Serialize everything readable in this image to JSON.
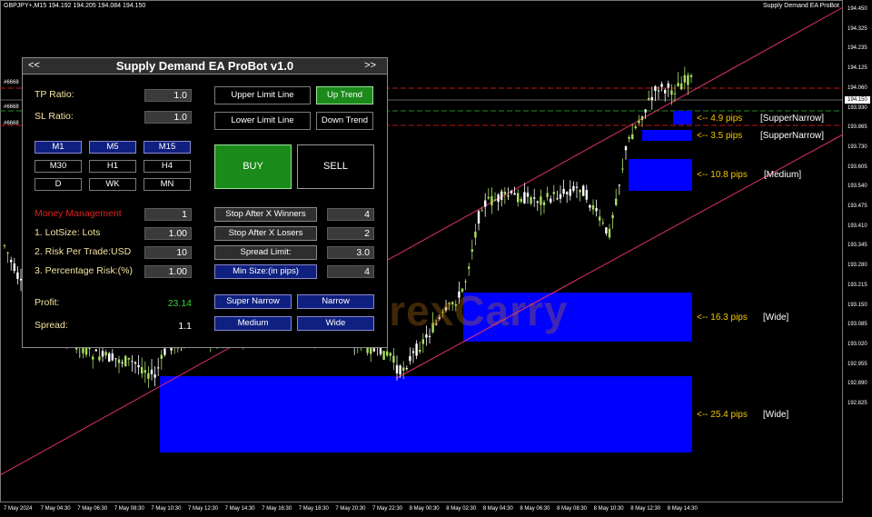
{
  "chart": {
    "symbol_info": "GBPJPY+,M15  194.192 194.205 194.084 194.150",
    "ea_name": "Supply Demand EA ProBot",
    "last_price": "194.150",
    "level_tags": [
      "#6668",
      "#6668",
      "#6668"
    ],
    "watermark": "ForexCarry",
    "y_ticks": [
      "194.450",
      "194.325",
      "194.235",
      "194.125",
      "194.060",
      "193.930",
      "193.865",
      "193.730",
      "193.605",
      "193.540",
      "193.475",
      "193.410",
      "193.345",
      "193.280",
      "193.215",
      "193.150",
      "193.085",
      "193.020",
      "192.955",
      "192.890",
      "192.825"
    ],
    "x_ticks": [
      "7 May 2024",
      "7 May 04:30",
      "7 May 06:30",
      "7 May 08:30",
      "7 May 10:30",
      "7 May 12:30",
      "7 May 14:30",
      "7 May 16:30",
      "7 May 18:30",
      "7 May 20:30",
      "7 May 22:30",
      "8 May 00:30",
      "8 May 02:30",
      "8 May 04:30",
      "8 May 06:30",
      "8 May 08:30",
      "8 May 10:30",
      "8 May 12:30",
      "8 May 14:30"
    ],
    "zones": [
      {
        "label": "<-- 4.9 pips",
        "kind": "[SupperNarrow]"
      },
      {
        "label": "<-- 3.5 pips",
        "kind": "[SupperNarrow]"
      },
      {
        "label": "<-- 10.8 pips",
        "kind": "[Medium]"
      },
      {
        "label": "<-- 16.3 pips",
        "kind": "[Wide]"
      },
      {
        "label": "<-- 25.4 pips",
        "kind": "[Wide]"
      }
    ],
    "colors": {
      "zone": "#0000ff",
      "channel": "#e0306a",
      "level_red": "#c01818",
      "level_green": "#208a20",
      "candle_bull": "#ffffff",
      "candle_bear": "#a8e060"
    }
  },
  "panel": {
    "nav_left": "<<",
    "title": "Supply Demand EA ProBot v1.0",
    "nav_right": ">>",
    "tp_ratio_label": "TP Ratio:",
    "tp_ratio_value": "1.0",
    "sl_ratio_label": "SL Ratio:",
    "sl_ratio_value": "1.0",
    "upper_limit_line": "Upper Limit Line",
    "lower_limit_line": "Lower Limit Line",
    "up_trend": "Up Trend",
    "down_trend": "Down Trend",
    "timeframes": [
      "M1",
      "M5",
      "M15",
      "M30",
      "H1",
      "H4",
      "D",
      "WK",
      "MN"
    ],
    "buy": "BUY",
    "sell": "SELL",
    "money_management_label": "Money Management",
    "money_management_value": "1",
    "lotsize_label": "1. LotSize: Lots",
    "lotsize_value": "1.00",
    "risk_usd_label": "2. Risk Per Trade:USD",
    "risk_usd_value": "10",
    "risk_pct_label": "3. Percentage Risk:(%)",
    "risk_pct_value": "1.00",
    "stop_winners": "Stop After X Winners",
    "stop_winners_value": "4",
    "stop_losers": "Stop After X Losers",
    "stop_losers_value": "2",
    "spread_limit": "Spread Limit:",
    "spread_limit_value": "3.0",
    "min_size": "Min Size:(in pips)",
    "min_size_value": "4",
    "profit_label": "Profit:",
    "profit_value": "23.14",
    "spread_label": "Spread:",
    "spread_value": "1.1",
    "super_narrow": "Super Narrow",
    "narrow": "Narrow",
    "medium": "Medium",
    "wide": "Wide"
  }
}
